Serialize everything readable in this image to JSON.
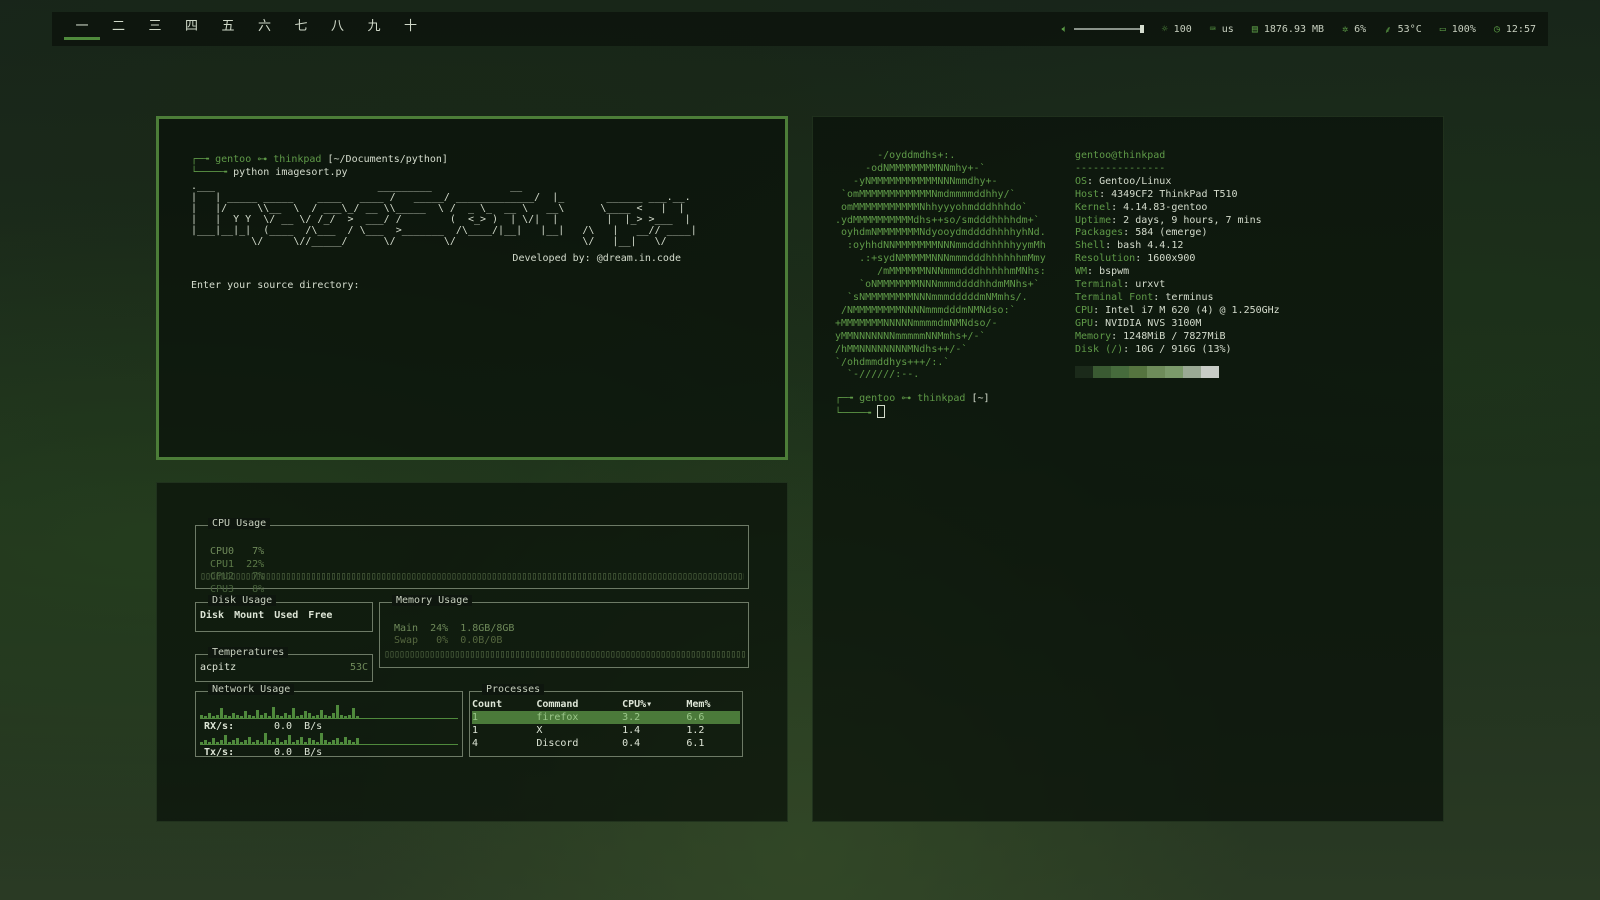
{
  "topbar": {
    "workspaces": [
      "一",
      "二",
      "三",
      "四",
      "五",
      "六",
      "七",
      "八",
      "九",
      "十"
    ],
    "active_workspace": 0,
    "status": {
      "volume_value": 100,
      "brightness": "100",
      "keyboard": "us",
      "memory": "1876.93 MB",
      "cpu": "6%",
      "temp": "53°C",
      "battery": "100%",
      "clock": "12:57"
    }
  },
  "term1": {
    "prompt_user": "gentoo",
    "prompt_arrow": "⊶",
    "prompt_host": "thinkpad",
    "prompt_path": "[~/Documents/python]",
    "command": "python imagesort.py",
    "banner": ".___                           _________             __                                \n|   | _____ _____    ____   ____ /   _____/ _____________/  |_       ______ ___.__.\n|   |/     \\\\__  \\  / ___\\_/ __ \\\\_____  \\ /  _ \\_  __ \\   __\\      \\____ <   |  |\n|   |  Y Y  \\/ __ \\/ /_/  >  ___/ /        (  <_> )  | \\/|  |        |  |_> >___  |\n|___|__|_|  (____  /\\___  / \\___  >_______  /\\____/|__|   |__|   /\\   |   __// ____|\n          \\/     \\//_____/      \\/        \\/                     \\/   |__|   \\/     ",
    "developed_by": "Developed by: @dream.in.code",
    "input_prompt": "Enter your source directory:"
  },
  "term2": {
    "logo": "       -/oyddmdhs+:.\n     -odNMMMMMMMMNNmhy+-`\n   -yNMMMMMMMMMMMNNNmmdhy+-\n `omMMMMMMMMMMMMNmdmmmmddhhy/`\n omMMMMMMMMMMMNhhyyyohmdddhhhdo`\n.ydMMMMMMMMMMdhs++so/smdddhhhhdm+`\n oyhdmNMMMMMMMNdyooydmddddhhhhyhNd.\n  :oyhhdNNMMMMMMMNNNmmdddhhhhhyymMh\n    .:+sydNMMMMMNNNmmmdddhhhhhhmMmy\n       /mMMMMMMNNNmmmdddhhhhhmMNhs:\n    `oNMMMMMMMNNNmmmddddhhdmMNhs+`\n  `sNMMMMMMMMNNNmmmdddddmNMmhs/.\n /NMMMMMMMMNNNNmmmdddmNMNdso:`\n+MMMMMMMNNNNNmmmmdmNMNdso/-\nyMMNNNNNNNmmmmmNNMmhs+/-`\n/hMMNNNNNNNNMNdhs++/-`\n`/ohdmmddhys+++/:.`\n  `-//////:--.",
    "fetch_user": "gentoo@thinkpad",
    "fetch_sep": "---------------",
    "info": [
      {
        "k": "OS",
        "v": "Gentoo/Linux"
      },
      {
        "k": "Host",
        "v": "4349CF2 ThinkPad T510"
      },
      {
        "k": "Kernel",
        "v": "4.14.83-gentoo"
      },
      {
        "k": "Uptime",
        "v": "2 days, 9 hours, 7 mins"
      },
      {
        "k": "Packages",
        "v": "584 (emerge)"
      },
      {
        "k": "Shell",
        "v": "bash 4.4.12"
      },
      {
        "k": "Resolution",
        "v": "1600x900"
      },
      {
        "k": "WM",
        "v": "bspwm"
      },
      {
        "k": "Terminal",
        "v": "urxvt"
      },
      {
        "k": "Terminal Font",
        "v": "terminus"
      },
      {
        "k": "CPU",
        "v": "Intel i7 M 620 (4) @ 1.250GHz"
      },
      {
        "k": "GPU",
        "v": "NVIDIA NVS 3100M"
      },
      {
        "k": "Memory",
        "v": "1248MiB / 7827MiB"
      },
      {
        "k": "Disk (/)",
        "v": "10G / 916G (13%)"
      }
    ],
    "palette": [
      "#1b2a1a",
      "#3a5a32",
      "#466b3c",
      "#55743f",
      "#6e8c5a",
      "#7b9a6a",
      "#9aa994",
      "#c8ccc6"
    ],
    "prompt_user": "gentoo",
    "prompt_arrow": "⊶",
    "prompt_host": "thinkpad",
    "prompt_path": "[~]"
  },
  "gotop": {
    "cpu_title": "CPU Usage",
    "cpus": [
      {
        "label": "CPU0",
        "val": "7%"
      },
      {
        "label": "CPU1",
        "val": "22%"
      },
      {
        "label": "CPU2",
        "val": "7%"
      },
      {
        "label": "CPU3",
        "val": "8%"
      }
    ],
    "disk_title": "Disk Usage",
    "disk_headers": [
      "Disk",
      "Mount",
      "Used",
      "Free"
    ],
    "temp_title": "Temperatures",
    "temp_name": "acpitz",
    "temp_val": "53C",
    "mem_title": "Memory Usage",
    "mem_main": "Main  24%  1.8GB/8GB",
    "mem_swap": "Swap   0%  0.0B/0B",
    "net_title": "Network Usage",
    "rx_label": "RX/s:",
    "rx_val": "0.0  B/s",
    "tx_label": "Tx/s:",
    "tx_val": "0.0  B/s",
    "proc_title": "Processes",
    "proc_headers": [
      "Count",
      "Command",
      "CPU%▾",
      "Mem%"
    ],
    "procs": [
      {
        "count": "1",
        "cmd": "firefox",
        "cpu": "3.2",
        "mem": "6.6"
      },
      {
        "count": "1",
        "cmd": "X",
        "cpu": "1.4",
        "mem": "1.2"
      },
      {
        "count": "4",
        "cmd": "Discord",
        "cpu": "0.4",
        "mem": "6.1"
      }
    ],
    "rx_spark": [
      2,
      1,
      3,
      1,
      2,
      6,
      2,
      1,
      3,
      2,
      1,
      4,
      2,
      1,
      5,
      2,
      3,
      1,
      7,
      2,
      1,
      3,
      2,
      6,
      1,
      2,
      4,
      3,
      1,
      2,
      5,
      2,
      1,
      3,
      8,
      2,
      1,
      2,
      6,
      1
    ],
    "tx_spark": [
      1,
      2,
      1,
      3,
      1,
      2,
      5,
      1,
      2,
      3,
      1,
      2,
      4,
      1,
      2,
      1,
      6,
      2,
      1,
      3,
      1,
      2,
      5,
      1,
      2,
      4,
      1,
      3,
      2,
      1,
      6,
      2,
      1,
      2,
      3,
      1,
      4,
      2,
      1,
      3
    ]
  }
}
